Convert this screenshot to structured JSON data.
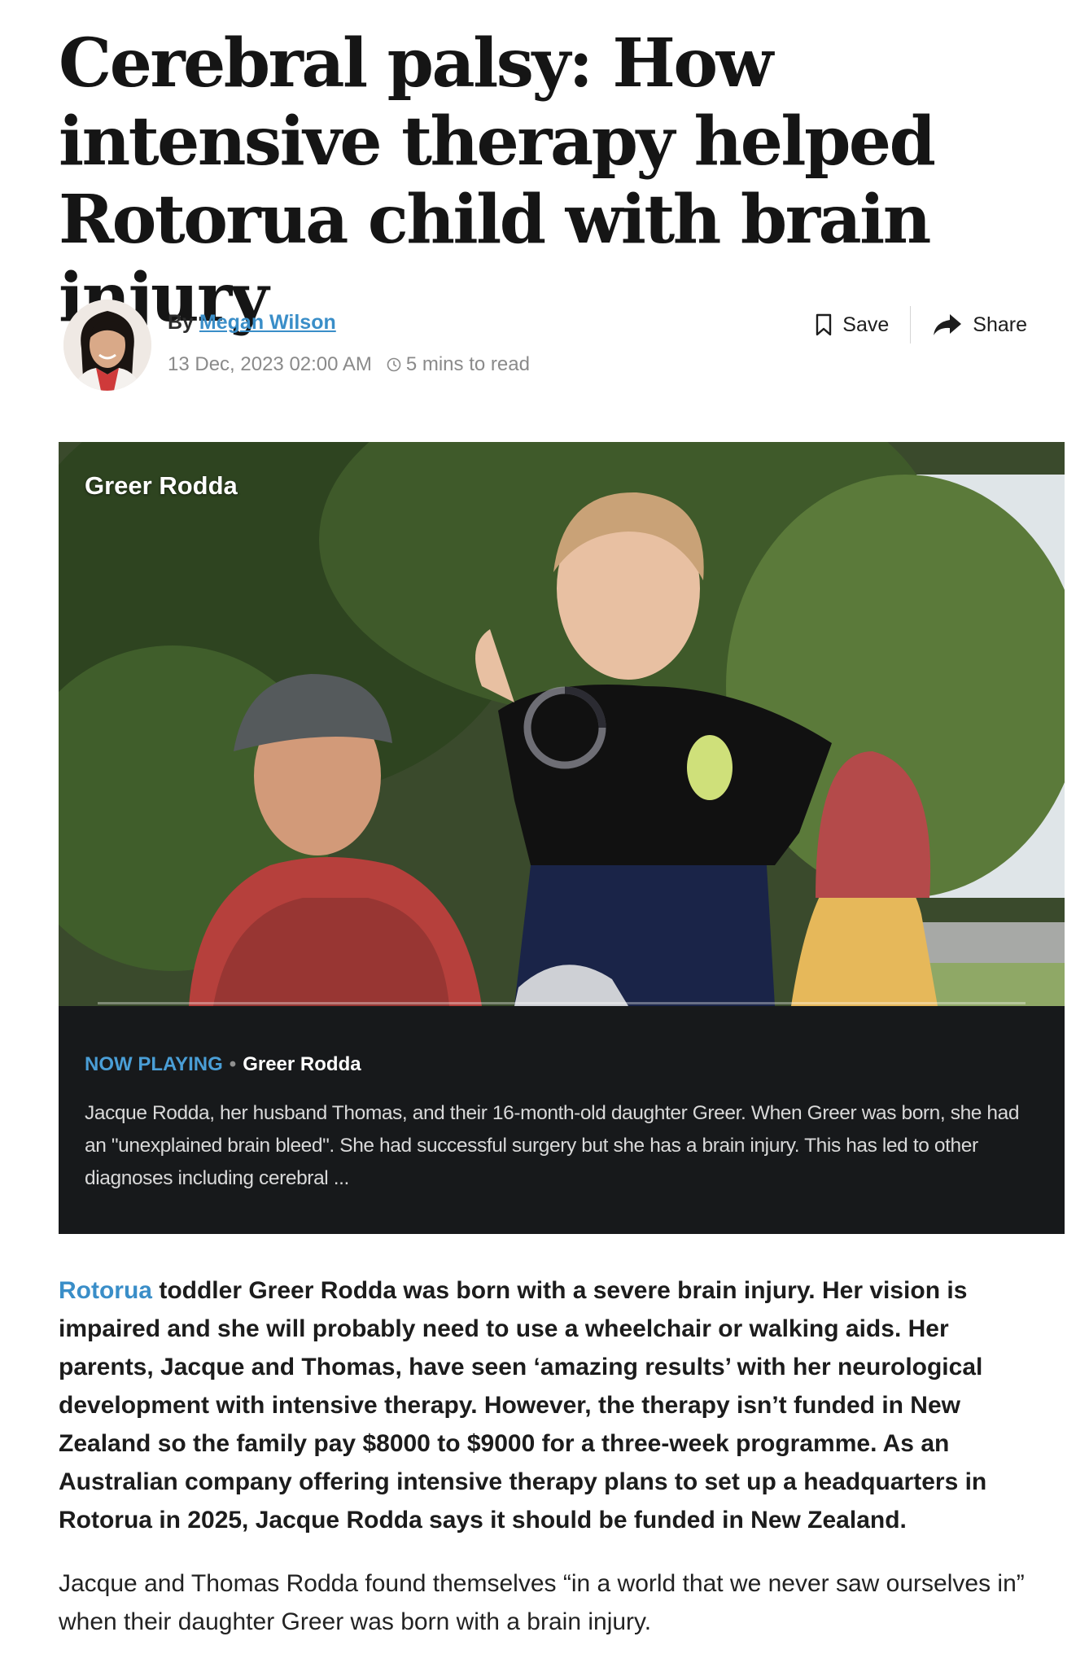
{
  "article": {
    "headline": "Cerebral palsy: How intensive therapy helped Rotorua child with brain injury",
    "byline_prefix": "By",
    "author": "Megan Wilson",
    "date": "13 Dec, 2023 02:00 AM",
    "read_time": "5 mins to read"
  },
  "actions": {
    "save": "Save",
    "share": "Share"
  },
  "video": {
    "overlay_title": "Greer Rodda",
    "now_playing_label": "NOW PLAYING",
    "separator": "•",
    "now_playing_title": "Greer Rodda",
    "caption": "Jacque Rodda, her husband Thomas, and their 16-month-old daughter Greer. When Greer was born, she had an \"unexplained brain bleed\". She had successful surgery but she has a brain injury. This has led to other diagnoses including cerebral ..."
  },
  "intro": {
    "link": "Rotorua",
    "text": " toddler Greer Rodda was born with a severe brain injury. Her vision is impaired and she will probably need to use a wheelchair or walking aids. Her parents, Jacque and Thomas, have seen ‘amazing results’ with her neurological development with intensive therapy. However, the therapy isn’t funded in New Zealand so the family pay $8000 to $9000 for a three-week programme. As an Australian company offering intensive therapy plans to set up a headquarters in Rotorua in 2025, Jacque Rodda says it should be funded in New Zealand."
  },
  "body": {
    "paragraph_1": "Jacque and Thomas Rodda found themselves “in a world that we never saw ourselves in” when their daughter Greer was born with a brain injury."
  },
  "icons": {
    "save": "bookmark-icon",
    "share": "share-arrow-icon",
    "clock": "clock-icon",
    "loading": "loading-spinner-icon"
  },
  "colors": {
    "link": "#3a8ec8",
    "caption_bg": "#17191b",
    "now_playing": "#4a9ed6"
  }
}
